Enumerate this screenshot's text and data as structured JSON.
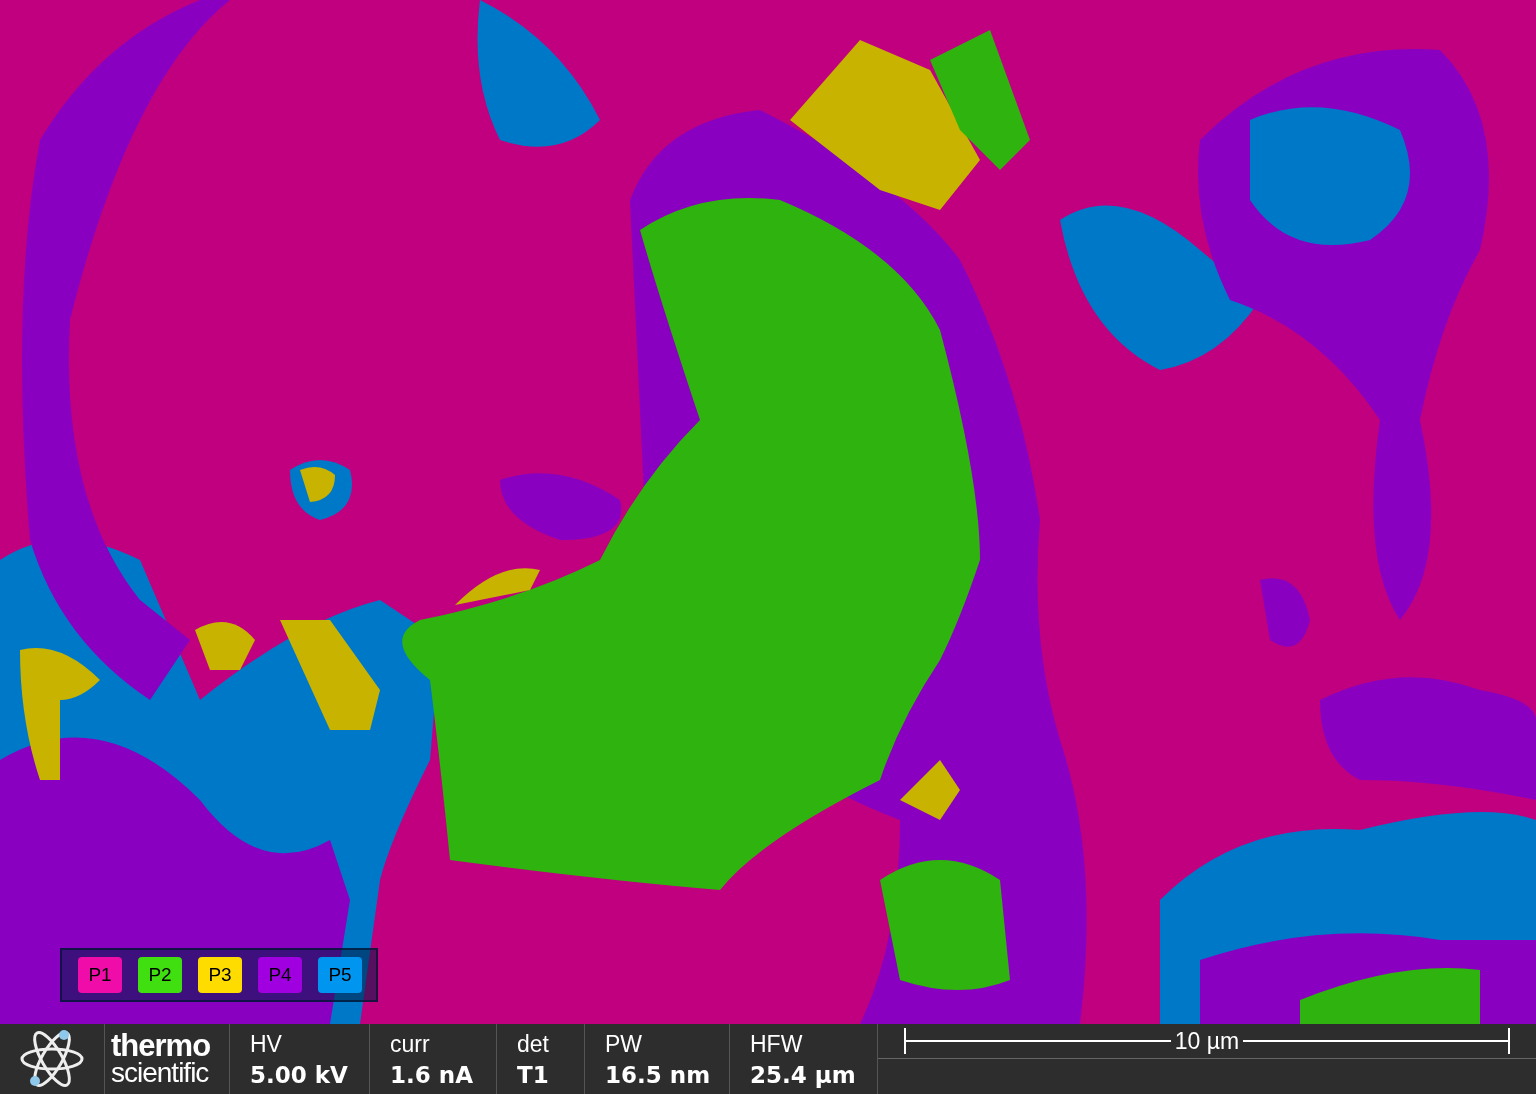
{
  "legend": [
    {
      "label": "P1",
      "color": "#f00ca8"
    },
    {
      "label": "P2",
      "color": "#40e010"
    },
    {
      "label": "P3",
      "color": "#ffdc00"
    },
    {
      "label": "P4",
      "color": "#a000e0"
    },
    {
      "label": "P5",
      "color": "#0096f0"
    }
  ],
  "databar": {
    "brand": [
      "thermo",
      "scientific"
    ],
    "fields": [
      {
        "name": "HV",
        "value": "5.00 kV"
      },
      {
        "name": "curr",
        "value": "1.6 nA"
      },
      {
        "name": "det",
        "value": "T1"
      },
      {
        "name": "PW",
        "value": "16.5 nm"
      },
      {
        "name": "HFW",
        "value": "25.4 µm"
      }
    ],
    "scale_bar": "10 µm"
  }
}
